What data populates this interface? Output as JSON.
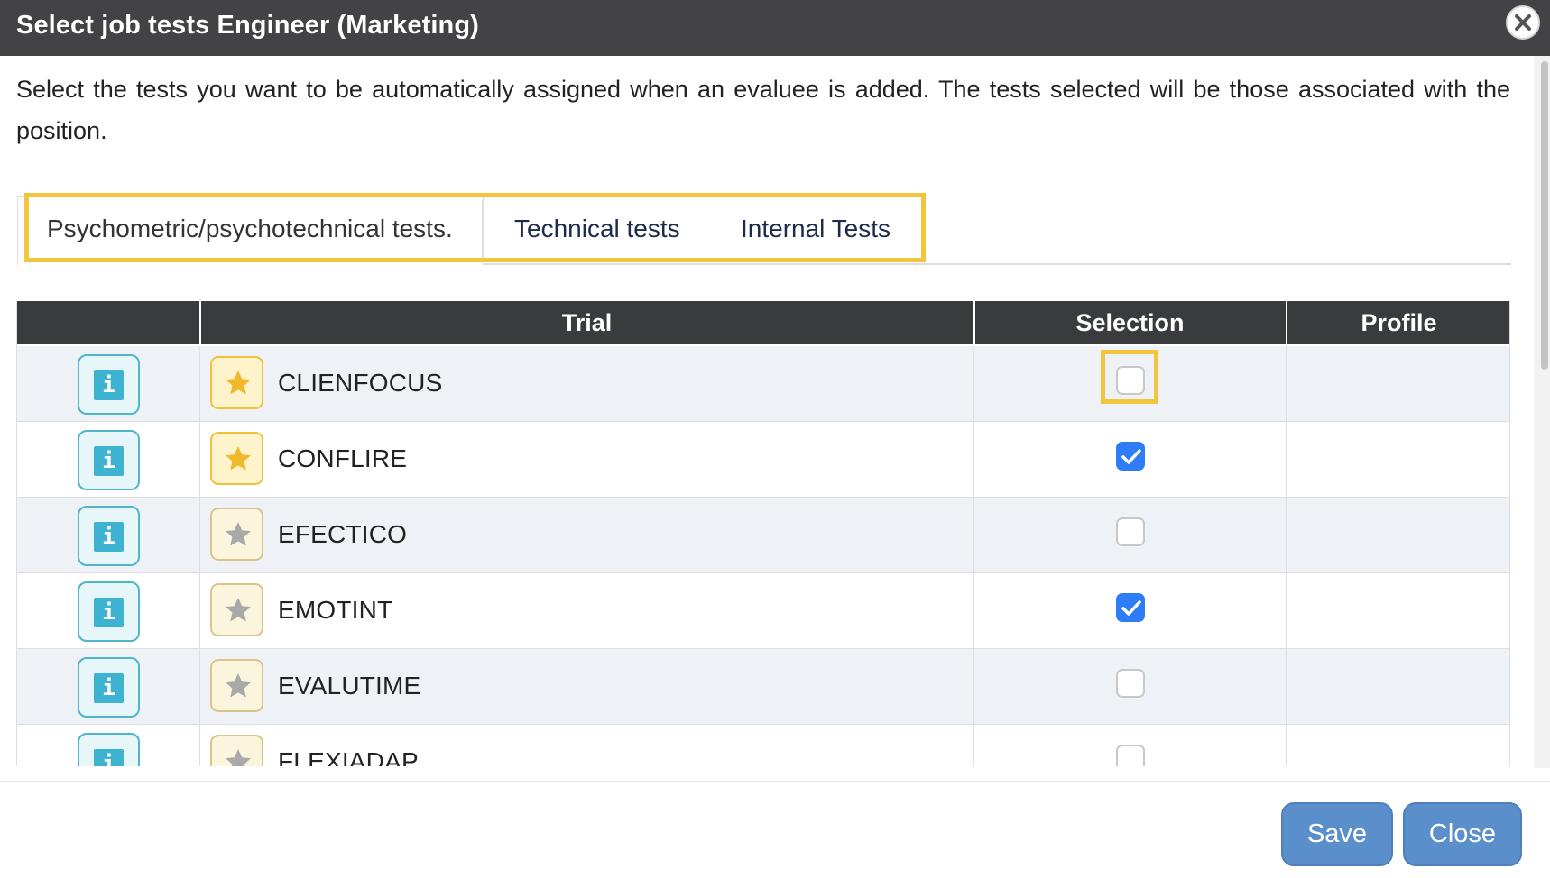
{
  "dialog": {
    "title": "Select job tests Engineer (Marketing)",
    "close_icon": "close-x-icon",
    "intro": "Select the tests you want to be automatically assigned when an evaluee is added. The tests selected will be those associated with the position."
  },
  "tabs": [
    {
      "label": "Psychometric/psychotechnical tests.",
      "active": true
    },
    {
      "label": "Technical tests",
      "active": false
    },
    {
      "label": "Internal Tests",
      "active": false
    }
  ],
  "table": {
    "headers": {
      "info": "",
      "trial": "Trial",
      "selection": "Selection",
      "profile": "Profile"
    },
    "rows": [
      {
        "name": "CLIENFOCUS",
        "starred": true,
        "selected": false,
        "profile": ""
      },
      {
        "name": "CONFLIRE",
        "starred": true,
        "selected": true,
        "profile": ""
      },
      {
        "name": "EFECTICO",
        "starred": false,
        "selected": false,
        "profile": ""
      },
      {
        "name": "EMOTINT",
        "starred": false,
        "selected": true,
        "profile": ""
      },
      {
        "name": "EVALUTIME",
        "starred": false,
        "selected": false,
        "profile": ""
      },
      {
        "name": "FLEXIADAP",
        "starred": false,
        "selected": false,
        "profile": ""
      }
    ],
    "info_glyph": "i"
  },
  "footer": {
    "save_label": "Save",
    "close_label": "Close"
  },
  "colors": {
    "titlebar": "#434345",
    "highlight": "#f3c53d",
    "button": "#5b8fcb",
    "checkbox_checked": "#2f7df6",
    "info": "#3eb2d1",
    "star_active": "#f0b92b",
    "star_inactive": "#a9a9a9"
  }
}
